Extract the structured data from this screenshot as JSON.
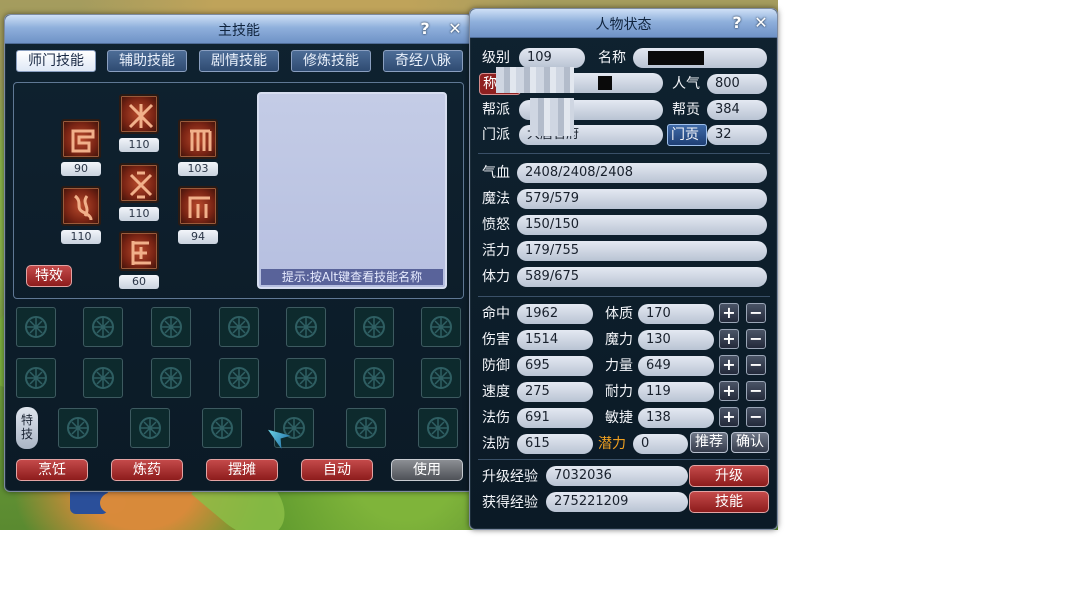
{
  "skill_window": {
    "title": "主技能",
    "help": "?",
    "close": "✕",
    "tabs": [
      {
        "label": "师门技能",
        "active": true
      },
      {
        "label": "辅助技能",
        "active": false
      },
      {
        "label": "剧情技能",
        "active": false
      },
      {
        "label": "修炼技能",
        "active": false
      },
      {
        "label": "奇经八脉",
        "active": false
      }
    ],
    "skills": [
      {
        "level": "90",
        "icon": "skill-icon-1"
      },
      {
        "level": "110",
        "icon": "skill-icon-2"
      },
      {
        "level": "103",
        "icon": "skill-icon-3"
      },
      {
        "level": "110",
        "icon": "skill-icon-4"
      },
      {
        "level": "110",
        "icon": "skill-icon-5"
      },
      {
        "level": "94",
        "icon": "skill-icon-6"
      },
      {
        "level": "60",
        "icon": "skill-icon-7"
      }
    ],
    "effect_button": "特效",
    "hint": "提示:按Alt键查看技能名称",
    "special_label": "特技",
    "bottom_buttons": {
      "cook": "烹饪",
      "alchemy": "炼药",
      "stall": "摆摊",
      "auto": "自动",
      "use": "使用"
    }
  },
  "status_window": {
    "title": "人物状态",
    "help": "?",
    "close": "✕",
    "level_label": "级别",
    "level": "109",
    "name_label": "名称",
    "title_label": "称",
    "popularity_label": "人气",
    "popularity": "800",
    "gang_label": "帮派",
    "gang_contribution_label": "帮贡",
    "gang_contribution": "384",
    "school_label": "门派",
    "school": "大唐官府",
    "school_contribution_label": "门贡",
    "school_contribution": "32",
    "hp_label": "气血",
    "hp": "2408/2408/2408",
    "mp_label": "魔法",
    "mp": "579/579",
    "anger_label": "愤怒",
    "anger": "150/150",
    "vitality_label": "活力",
    "vitality": "179/755",
    "stamina_label": "体力",
    "stamina": "589/675",
    "stats": [
      {
        "label": "命中",
        "value": "1962",
        "attr_label": "体质",
        "attr_value": "170"
      },
      {
        "label": "伤害",
        "value": "1514",
        "attr_label": "魔力",
        "attr_value": "130"
      },
      {
        "label": "防御",
        "value": "695",
        "attr_label": "力量",
        "attr_value": "649"
      },
      {
        "label": "速度",
        "value": "275",
        "attr_label": "耐力",
        "attr_value": "119"
      },
      {
        "label": "法伤",
        "value": "691",
        "attr_label": "敏捷",
        "attr_value": "138"
      }
    ],
    "plus": "+",
    "minus": "−",
    "magic_def_label": "法防",
    "magic_def": "615",
    "potential_label": "潜力",
    "potential": "0",
    "recommend_button": "推荐",
    "confirm_button": "确认",
    "upgrade_exp_label": "升级经验",
    "upgrade_exp": "7032036",
    "gained_exp_label": "获得经验",
    "gained_exp": "275221209",
    "upgrade_button": "升级",
    "skills_button": "技能"
  },
  "colors": {
    "potential_label": "#f0a020",
    "active_tab": "#ffffff",
    "red_button": "#a82a2a"
  }
}
